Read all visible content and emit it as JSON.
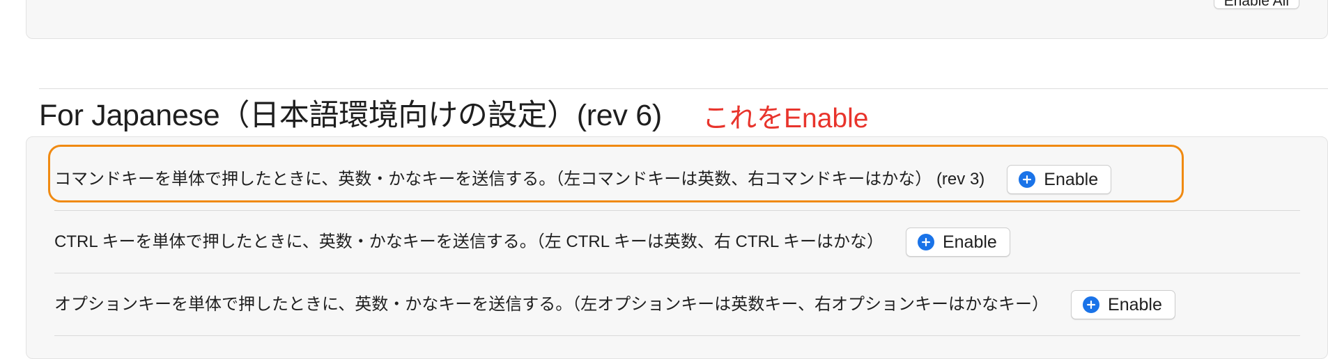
{
  "previous_section": {
    "enable_all_label": "Enable All"
  },
  "section": {
    "title": "For Japanese（日本語環境向けの設定）(rev 6)"
  },
  "annotation": {
    "note": "これをEnable",
    "note_color": "#e8342c",
    "highlight_color": "#f08a12"
  },
  "rules": [
    {
      "description": "コマンドキーを単体で押したときに、英数・かなキーを送信する。（左コマンドキーは英数、右コマンドキーはかな） (rev 3)",
      "button_label": "Enable",
      "button_icon": "plus-circle-icon"
    },
    {
      "description": "CTRL キーを単体で押したときに、英数・かなキーを送信する。（左 CTRL キーは英数、右 CTRL キーはかな）",
      "button_label": "Enable",
      "button_icon": "plus-circle-icon"
    },
    {
      "description": "オプションキーを単体で押したときに、英数・かなキーを送信する。（左オプションキーは英数キー、右オプションキーはかなキー）",
      "button_label": "Enable",
      "button_icon": "plus-circle-icon"
    }
  ],
  "colors": {
    "accent": "#1a73e8"
  }
}
